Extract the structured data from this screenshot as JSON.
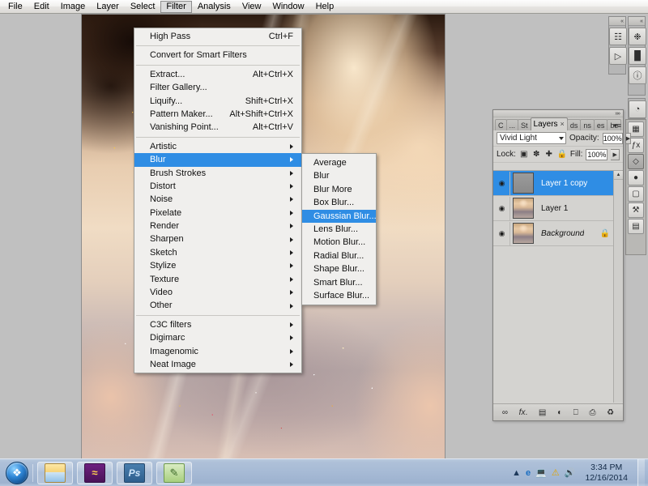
{
  "app": {
    "name": "Adobe Photoshop"
  },
  "menubar": {
    "items": [
      {
        "label": "File",
        "active": false
      },
      {
        "label": "Edit",
        "active": false
      },
      {
        "label": "Image",
        "active": false
      },
      {
        "label": "Layer",
        "active": false
      },
      {
        "label": "Select",
        "active": false
      },
      {
        "label": "Filter",
        "active": true
      },
      {
        "label": "Analysis",
        "active": false
      },
      {
        "label": "View",
        "active": false
      },
      {
        "label": "Window",
        "active": false
      },
      {
        "label": "Help",
        "active": false
      }
    ]
  },
  "filter_menu": {
    "groups": [
      [
        {
          "label": "High Pass",
          "accel": "Ctrl+F",
          "submenu": false
        }
      ],
      [
        {
          "label": "Convert for Smart Filters",
          "accel": "",
          "submenu": false
        }
      ],
      [
        {
          "label": "Extract...",
          "accel": "Alt+Ctrl+X",
          "submenu": false
        },
        {
          "label": "Filter Gallery...",
          "accel": "",
          "submenu": false
        },
        {
          "label": "Liquify...",
          "accel": "Shift+Ctrl+X",
          "submenu": false
        },
        {
          "label": "Pattern Maker...",
          "accel": "Alt+Shift+Ctrl+X",
          "submenu": false
        },
        {
          "label": "Vanishing Point...",
          "accel": "Alt+Ctrl+V",
          "submenu": false
        }
      ],
      [
        {
          "label": "Artistic",
          "accel": "",
          "submenu": true
        },
        {
          "label": "Blur",
          "accel": "",
          "submenu": true,
          "highlighted": true
        },
        {
          "label": "Brush Strokes",
          "accel": "",
          "submenu": true
        },
        {
          "label": "Distort",
          "accel": "",
          "submenu": true
        },
        {
          "label": "Noise",
          "accel": "",
          "submenu": true
        },
        {
          "label": "Pixelate",
          "accel": "",
          "submenu": true
        },
        {
          "label": "Render",
          "accel": "",
          "submenu": true
        },
        {
          "label": "Sharpen",
          "accel": "",
          "submenu": true
        },
        {
          "label": "Sketch",
          "accel": "",
          "submenu": true
        },
        {
          "label": "Stylize",
          "accel": "",
          "submenu": true
        },
        {
          "label": "Texture",
          "accel": "",
          "submenu": true
        },
        {
          "label": "Video",
          "accel": "",
          "submenu": true
        },
        {
          "label": "Other",
          "accel": "",
          "submenu": true
        }
      ],
      [
        {
          "label": "C3C filters",
          "accel": "",
          "submenu": true
        },
        {
          "label": "Digimarc",
          "accel": "",
          "submenu": true
        },
        {
          "label": "Imagenomic",
          "accel": "",
          "submenu": true
        },
        {
          "label": "Neat Image",
          "accel": "",
          "submenu": true
        }
      ]
    ]
  },
  "blur_submenu": {
    "items": [
      {
        "label": "Average",
        "highlighted": false
      },
      {
        "label": "Blur",
        "highlighted": false
      },
      {
        "label": "Blur More",
        "highlighted": false
      },
      {
        "label": "Box Blur...",
        "highlighted": false
      },
      {
        "label": "Gaussian Blur...",
        "highlighted": true
      },
      {
        "label": "Lens Blur...",
        "highlighted": false
      },
      {
        "label": "Motion Blur...",
        "highlighted": false
      },
      {
        "label": "Radial Blur...",
        "highlighted": false
      },
      {
        "label": "Shape Blur...",
        "highlighted": false
      },
      {
        "label": "Smart Blur...",
        "highlighted": false
      },
      {
        "label": "Surface Blur...",
        "highlighted": false
      }
    ]
  },
  "layers_panel": {
    "tabs": [
      {
        "label": "C",
        "active": false
      },
      {
        "label": "...",
        "active": false
      },
      {
        "label": "St",
        "active": false
      },
      {
        "label": "Layers",
        "active": true,
        "closable": true
      },
      {
        "label": "ds",
        "active": false
      },
      {
        "label": "ns",
        "active": false
      },
      {
        "label": "es",
        "active": false
      },
      {
        "label": "be",
        "active": false
      }
    ],
    "blend_mode": "Vivid Light",
    "opacity_label": "Opacity:",
    "opacity_value": "100%",
    "lock_label": "Lock:",
    "fill_label": "Fill:",
    "fill_value": "100%",
    "lock_icons": [
      "lock-transparent-icon",
      "lock-image-icon",
      "lock-position-icon",
      "lock-all-icon"
    ],
    "layers": [
      {
        "name": "Layer 1 copy",
        "selected": true,
        "visible": true,
        "thumb": "gray",
        "locked": false,
        "italic": false
      },
      {
        "name": "Layer 1",
        "selected": false,
        "visible": true,
        "thumb": "photo",
        "locked": false,
        "italic": false
      },
      {
        "name": "Background",
        "selected": false,
        "visible": true,
        "thumb": "photo",
        "locked": true,
        "italic": true
      }
    ],
    "footer_icons": [
      "link-layers-icon",
      "layer-style-fx-icon",
      "add-layer-mask-icon",
      "new-adjustment-layer-icon",
      "new-group-icon",
      "new-layer-icon",
      "delete-layer-icon"
    ]
  },
  "dock": {
    "top_left_icons": [
      "navigator-icon",
      "histogram-icon"
    ],
    "top_right_icons": [
      "color-wheel-icon",
      "histogram-panel-icon",
      "info-icon"
    ],
    "rail_icons": [
      "swatches-icon",
      "styles-fx-icon",
      "layers-stack-icon",
      "adjustments-sphere-icon",
      "paths-icon",
      "brushes-icon",
      "actions-icon"
    ]
  },
  "taskbar": {
    "start_label": "start-orb",
    "buttons": [
      {
        "name": "windows-explorer-button",
        "icon": "folder-icon",
        "glyph": ""
      },
      {
        "name": "purple-app-button",
        "icon": "purple-app-icon",
        "glyph": "≈"
      },
      {
        "name": "photoshop-button",
        "icon": "photoshop-icon",
        "glyph": "Ps"
      },
      {
        "name": "green-app-button",
        "icon": "green-app-icon",
        "glyph": "✎"
      }
    ],
    "tray": [
      {
        "name": "show-hidden-icons-button",
        "glyph": "▲"
      },
      {
        "name": "internet-explorer-tray-icon",
        "glyph": "e"
      },
      {
        "name": "network-tray-icon",
        "glyph": "⌗"
      },
      {
        "name": "action-center-tray-icon",
        "glyph": "⚠"
      },
      {
        "name": "volume-tray-icon",
        "glyph": "◂))"
      }
    ],
    "clock_time": "3:34 PM",
    "clock_date": "12/16/2014"
  },
  "colors": {
    "menu_highlight": "#2f8de4",
    "menu_bg": "#f0efed",
    "workspace_bg": "#c0c0c0",
    "panel_bg": "#d4d3d0",
    "taskbar_bg": "#a6bad5"
  }
}
